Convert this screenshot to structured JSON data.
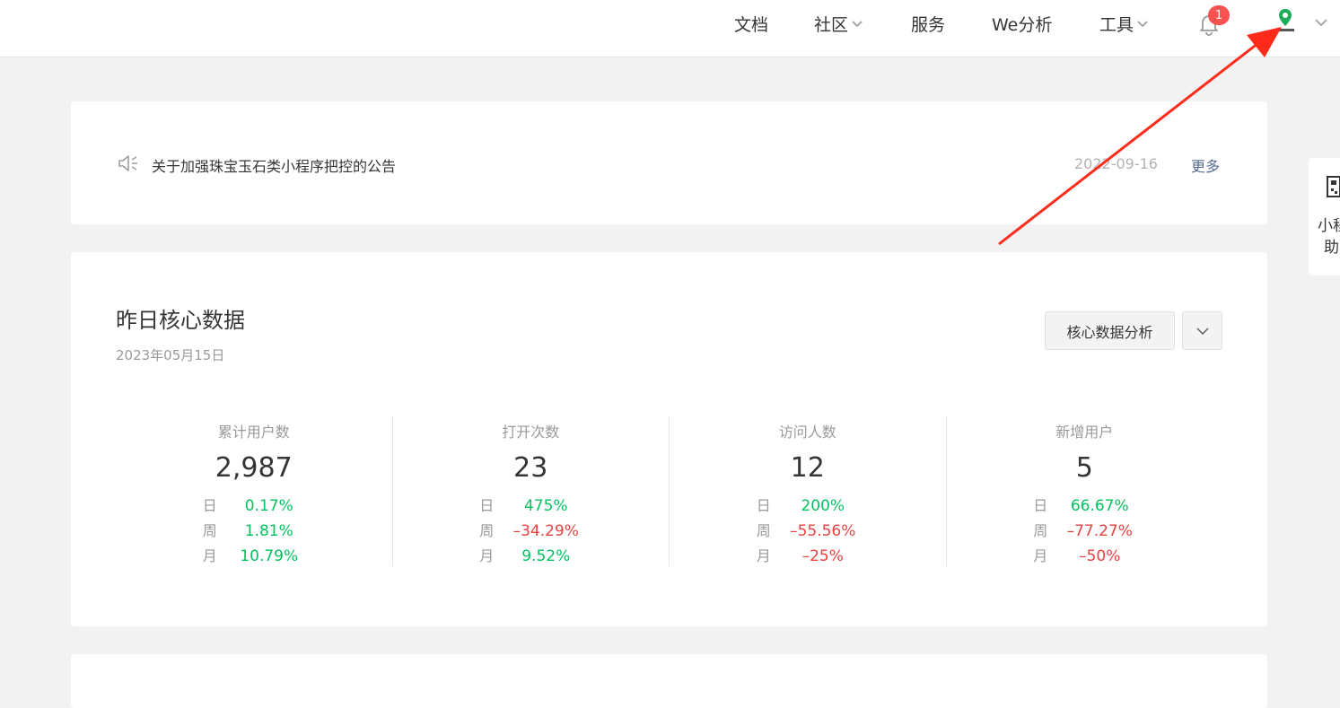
{
  "nav": {
    "docs": "文档",
    "community": "社区",
    "service": "服务",
    "we_analysis": "We分析",
    "tools": "工具"
  },
  "notifications": {
    "count": "1"
  },
  "notice": {
    "title": "关于加强珠宝玉石类小程序把控的公告",
    "date": "2022-09-16",
    "more": "更多"
  },
  "core": {
    "title": "昨日核心数据",
    "date": "2023年05月15日",
    "analysis_button": "核心数据分析",
    "metrics": [
      {
        "label": "累计用户数",
        "value": "2,987",
        "rows": [
          {
            "k": "日",
            "v": "0.17%",
            "trend": "up"
          },
          {
            "k": "周",
            "v": "1.81%",
            "trend": "up"
          },
          {
            "k": "月",
            "v": "10.79%",
            "trend": "up"
          }
        ]
      },
      {
        "label": "打开次数",
        "value": "23",
        "rows": [
          {
            "k": "日",
            "v": "475%",
            "trend": "up"
          },
          {
            "k": "周",
            "v": "–34.29%",
            "trend": "down"
          },
          {
            "k": "月",
            "v": "9.52%",
            "trend": "up"
          }
        ]
      },
      {
        "label": "访问人数",
        "value": "12",
        "rows": [
          {
            "k": "日",
            "v": "200%",
            "trend": "up"
          },
          {
            "k": "周",
            "v": "–55.56%",
            "trend": "down"
          },
          {
            "k": "月",
            "v": "–25%",
            "trend": "down"
          }
        ]
      },
      {
        "label": "新增用户",
        "value": "5",
        "rows": [
          {
            "k": "日",
            "v": "66.67%",
            "trend": "up"
          },
          {
            "k": "周",
            "v": "–77.27%",
            "trend": "down"
          },
          {
            "k": "月",
            "v": "–50%",
            "trend": "down"
          }
        ]
      }
    ]
  },
  "side_tab": {
    "line1": "小程",
    "line2": "助"
  },
  "colors": {
    "up": "#07c160",
    "down": "#e64340",
    "link": "#576b95",
    "badge": "#fa5151",
    "annotation_arrow": "#ff2a1a"
  },
  "icons": [
    "bell-icon",
    "avatar-location-pin-icon",
    "chevron-down-icon",
    "speaker-icon",
    "qr-code-icon",
    "annotation-arrow"
  ]
}
